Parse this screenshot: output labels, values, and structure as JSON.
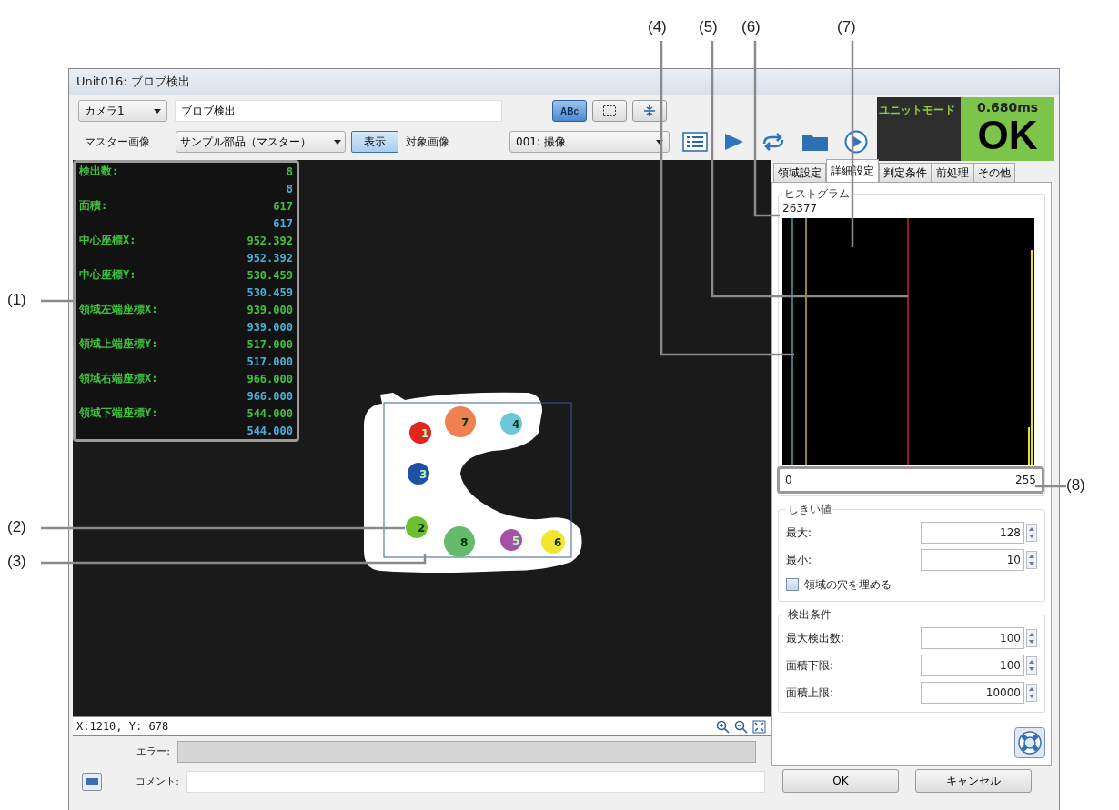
{
  "callouts": [
    {
      "label": "(1)"
    },
    {
      "label": "(2)"
    },
    {
      "label": "(3)"
    },
    {
      "label": "(4)"
    },
    {
      "label": "(5)"
    },
    {
      "label": "(6)"
    },
    {
      "label": "(7)"
    },
    {
      "label": "(8)"
    }
  ],
  "window": {
    "title": "Unit016: ブロブ検出"
  },
  "toolbar": {
    "camera": "カメラ1",
    "unit_name": "ブロブ検出",
    "view_buttons": [
      {
        "kind": "text",
        "label": "ABc",
        "selected": true
      },
      {
        "kind": "frame",
        "selected": false
      },
      {
        "kind": "fit",
        "selected": false
      }
    ],
    "master_label": "マスター画像",
    "master_image": "サンプル部品（マスター）",
    "show_button": "表示",
    "target_label": "対象画像",
    "target_image": "001: 撮像"
  },
  "status": {
    "mode": "ユニットモード",
    "time": "0.680ms",
    "result": "OK"
  },
  "results": [
    {
      "label": "検出数:",
      "value": "8",
      "reference": "8"
    },
    {
      "label": "面積:",
      "value": "617",
      "reference": "617"
    },
    {
      "label": "中心座標X:",
      "value": "952.392",
      "reference": "952.392"
    },
    {
      "label": "中心座標Y:",
      "value": "530.459",
      "reference": "530.459"
    },
    {
      "label": "領域左端座標X:",
      "value": "939.000",
      "reference": "939.000"
    },
    {
      "label": "領域上端座標Y:",
      "value": "517.000",
      "reference": "517.000"
    },
    {
      "label": "領域右端座標X:",
      "value": "966.000",
      "reference": "966.000"
    },
    {
      "label": "領域下端座標Y:",
      "value": "544.000",
      "reference": "544.000"
    }
  ],
  "image": {
    "blobs": [
      {
        "number": "1",
        "color": "#e52320"
      },
      {
        "number": "7",
        "color": "#ef8050"
      },
      {
        "number": "4",
        "color": "#6cc8d8"
      },
      {
        "number": "3",
        "color": "#1f4fa8"
      },
      {
        "number": "2",
        "color": "#6cbf2e"
      },
      {
        "number": "8",
        "color": "#66bb6a"
      },
      {
        "number": "5",
        "color": "#a54fa8"
      },
      {
        "number": "6",
        "color": "#f0e630"
      }
    ],
    "coordinates": "X:1210, Y: 678"
  },
  "tabs": [
    {
      "label": "領域設定",
      "selected": false
    },
    {
      "label": "詳細設定",
      "selected": true
    },
    {
      "label": "判定条件",
      "selected": false
    },
    {
      "label": "前処理",
      "selected": false
    },
    {
      "label": "その他",
      "selected": false
    }
  ],
  "histogram": {
    "title": "ヒストグラム",
    "max_count": "26377",
    "axis_min": "0",
    "axis_max": "255"
  },
  "threshold": {
    "title": "しきい値",
    "fields": [
      {
        "label": "最大:",
        "value": "128"
      },
      {
        "label": "最小:",
        "value": "10"
      }
    ],
    "fill_holes": {
      "label": "領域の穴を埋める",
      "checked": false
    }
  },
  "detection": {
    "title": "検出条件",
    "fields": [
      {
        "label": "最大検出数:",
        "value": "100"
      },
      {
        "label": "面積下限:",
        "value": "100"
      },
      {
        "label": "面積上限:",
        "value": "10000"
      }
    ]
  },
  "error_label": "エラー:",
  "comment_label": "コメント:",
  "buttons": [
    "OK",
    "キャンセル"
  ]
}
